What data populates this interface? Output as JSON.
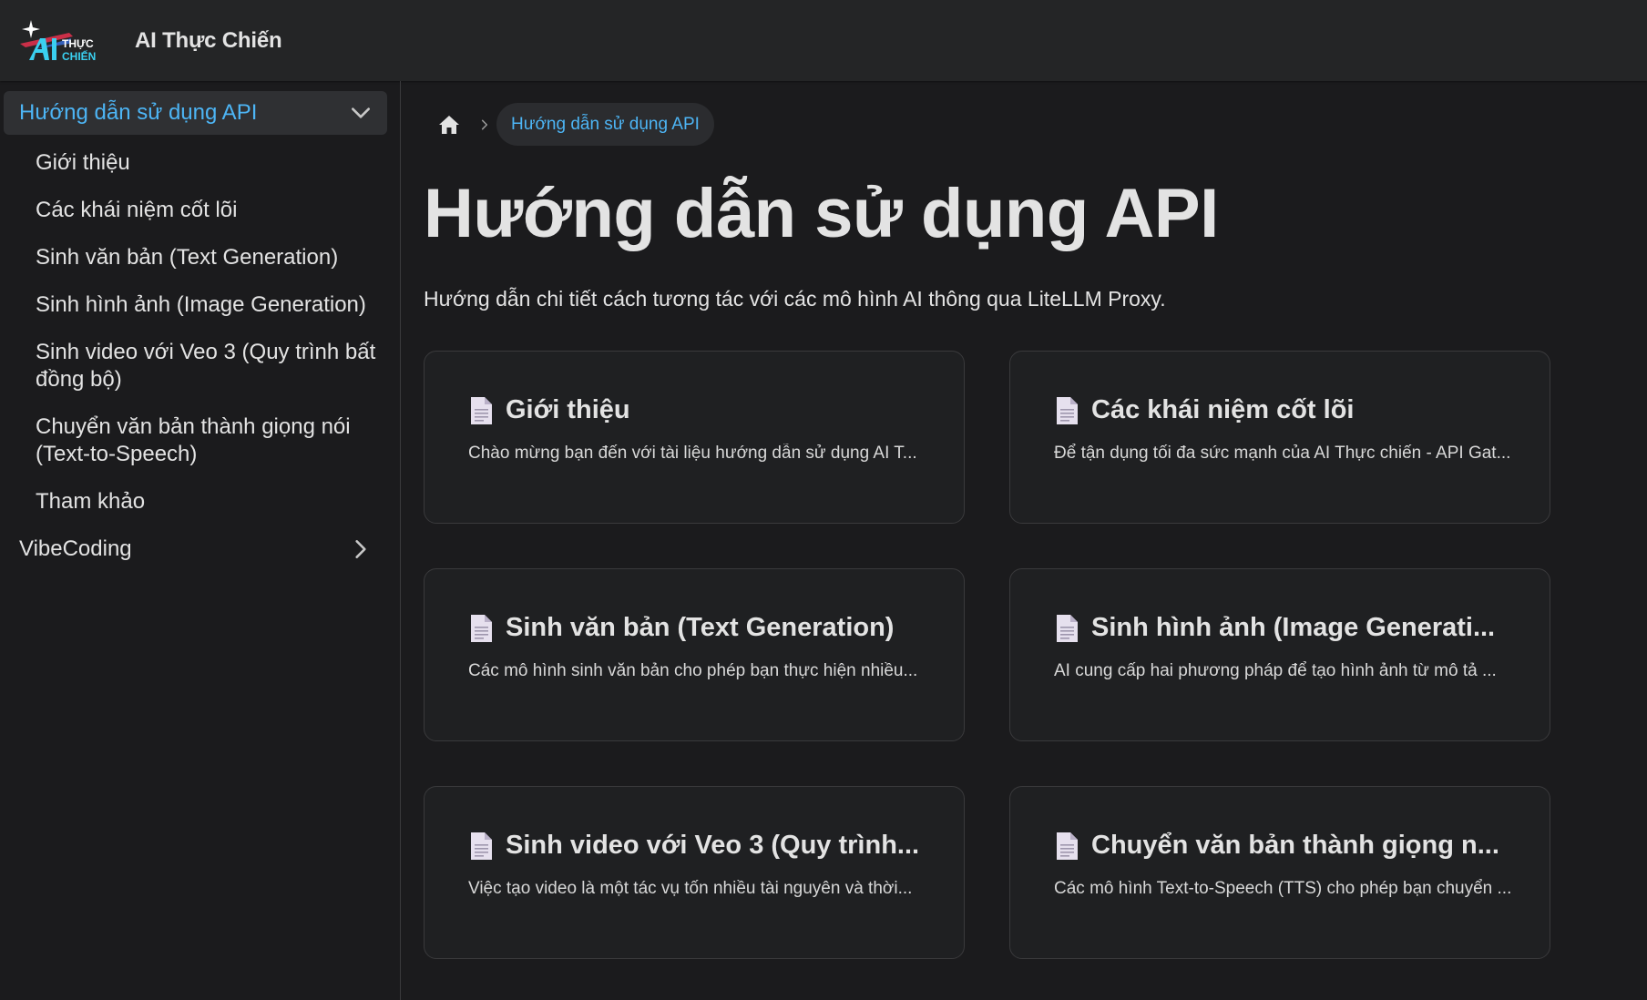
{
  "brand": {
    "title": "AI Thực Chiến",
    "logo_icon": "ai-thuc-chien-logo",
    "logo_text_line1": "THỰC",
    "logo_text_line2": "CHIẾN"
  },
  "sidebar": {
    "categories": [
      {
        "label": "Hướng dẫn sử dụng API",
        "expanded": true,
        "icon": "chevron-down-icon",
        "items": [
          {
            "label": "Giới thiệu"
          },
          {
            "label": "Các khái niệm cốt lõi"
          },
          {
            "label": "Sinh văn bản (Text Generation)"
          },
          {
            "label": "Sinh hình ảnh (Image Generation)"
          },
          {
            "label": "Sinh video với Veo 3 (Quy trình bất đồng bộ)"
          },
          {
            "label": "Chuyển văn bản thành giọng nói (Text-to-Speech)"
          },
          {
            "label": "Tham khảo"
          }
        ]
      },
      {
        "label": "VibeCoding",
        "expanded": false,
        "icon": "chevron-right-icon"
      }
    ]
  },
  "breadcrumb": {
    "home_icon": "home-icon",
    "separator_icon": "chevron-right-icon",
    "current": "Hướng dẫn sử dụng API"
  },
  "main": {
    "title": "Hướng dẫn sử dụng API",
    "description": "Hướng dẫn chi tiết cách tương tác với các mô hình AI thông qua LiteLLM Proxy.",
    "cards": [
      {
        "icon": "document-icon",
        "title": "Giới thiệu",
        "description": "Chào mừng bạn đến với tài liệu hướng dẫn sử dụng AI T..."
      },
      {
        "icon": "document-icon",
        "title": "Các khái niệm cốt lõi",
        "description": "Để tận dụng tối đa sức mạnh của AI Thực chiến - API Gat..."
      },
      {
        "icon": "document-icon",
        "title": "Sinh văn bản (Text Generation)",
        "description": "Các mô hình sinh văn bản cho phép bạn thực hiện nhiều..."
      },
      {
        "icon": "document-icon",
        "title": "Sinh hình ảnh (Image Generati...",
        "description": "AI cung cấp hai phương pháp để tạo hình ảnh từ mô tả ..."
      },
      {
        "icon": "document-icon",
        "title": "Sinh video với Veo 3 (Quy trình...",
        "description": "Việc tạo video là một tác vụ tốn nhiều tài nguyên và thời..."
      },
      {
        "icon": "document-icon",
        "title": "Chuyển văn bản thành giọng n...",
        "description": "Các mô hình Text-to-Speech (TTS) cho phép bạn chuyển ..."
      }
    ]
  },
  "colors": {
    "background": "#1b1b1d",
    "navbar": "#242526",
    "link_active": "#4db5f5",
    "text": "#e3e3e3"
  }
}
